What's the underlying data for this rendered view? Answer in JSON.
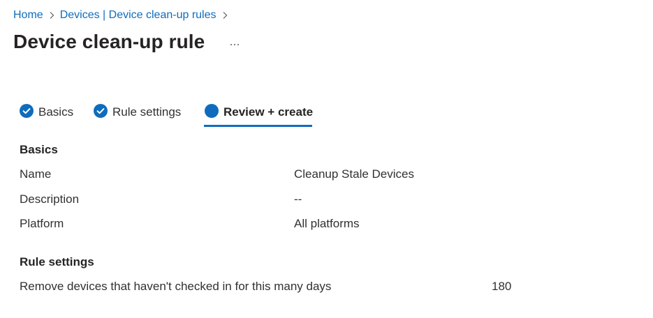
{
  "breadcrumb": {
    "items": [
      {
        "label": "Home"
      },
      {
        "label": "Devices | Device clean-up rules"
      }
    ]
  },
  "page": {
    "title": "Device clean-up rule",
    "more_icon": "ellipsis-icon"
  },
  "tabs": [
    {
      "label": "Basics",
      "icon": "checkmark-circle-icon",
      "state": "completed"
    },
    {
      "label": "Rule settings",
      "icon": "checkmark-circle-icon",
      "state": "completed"
    },
    {
      "label": "Review + create",
      "icon": "filled-circle-icon",
      "state": "active"
    }
  ],
  "review": {
    "basics": {
      "heading": "Basics",
      "rows": [
        {
          "label": "Name",
          "value": "Cleanup Stale Devices"
        },
        {
          "label": "Description",
          "value": "--"
        },
        {
          "label": "Platform",
          "value": "All platforms"
        }
      ]
    },
    "rule_settings": {
      "heading": "Rule settings",
      "rows": [
        {
          "label": "Remove devices that haven't checked in for this many days",
          "value": "180"
        }
      ]
    }
  },
  "colors": {
    "accent": "#0f6cbd",
    "text": "#323130",
    "heading": "#252423"
  }
}
